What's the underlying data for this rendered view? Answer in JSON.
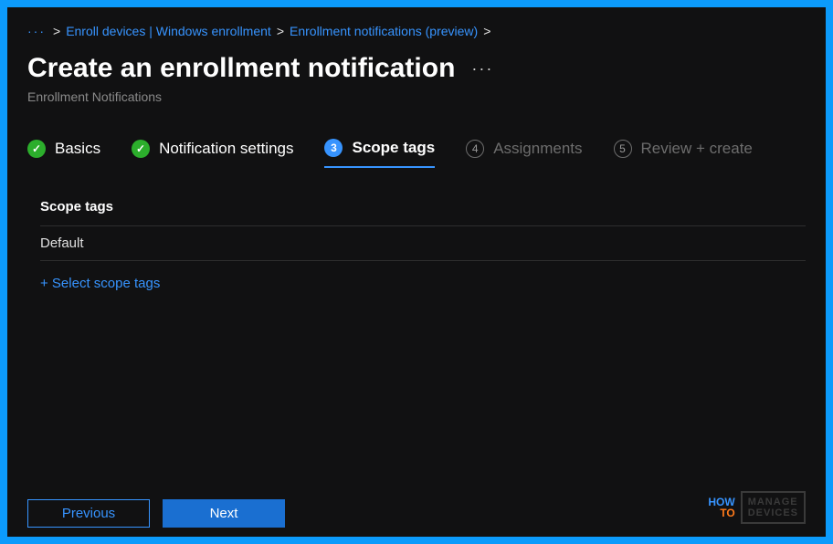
{
  "breadcrumb": {
    "dots": "···",
    "item1": "Enroll devices | Windows enrollment",
    "item2": "Enrollment notifications (preview)",
    "sep": ">"
  },
  "header": {
    "title": "Create an enrollment notification",
    "more": "···",
    "subtitle": "Enrollment Notifications"
  },
  "tabs": {
    "t1": {
      "label": "Basics"
    },
    "t2": {
      "label": "Notification settings"
    },
    "t3": {
      "num": "3",
      "label": "Scope tags"
    },
    "t4": {
      "num": "4",
      "label": "Assignments"
    },
    "t5": {
      "num": "5",
      "label": "Review + create"
    }
  },
  "content": {
    "section_label": "Scope tags",
    "row1": "Default",
    "add_link": "+ Select scope tags"
  },
  "footer": {
    "previous": "Previous",
    "next": "Next"
  },
  "watermark": {
    "how": "HOW",
    "to": "TO",
    "manage": "MANAGE",
    "devices": "DEVICES"
  }
}
